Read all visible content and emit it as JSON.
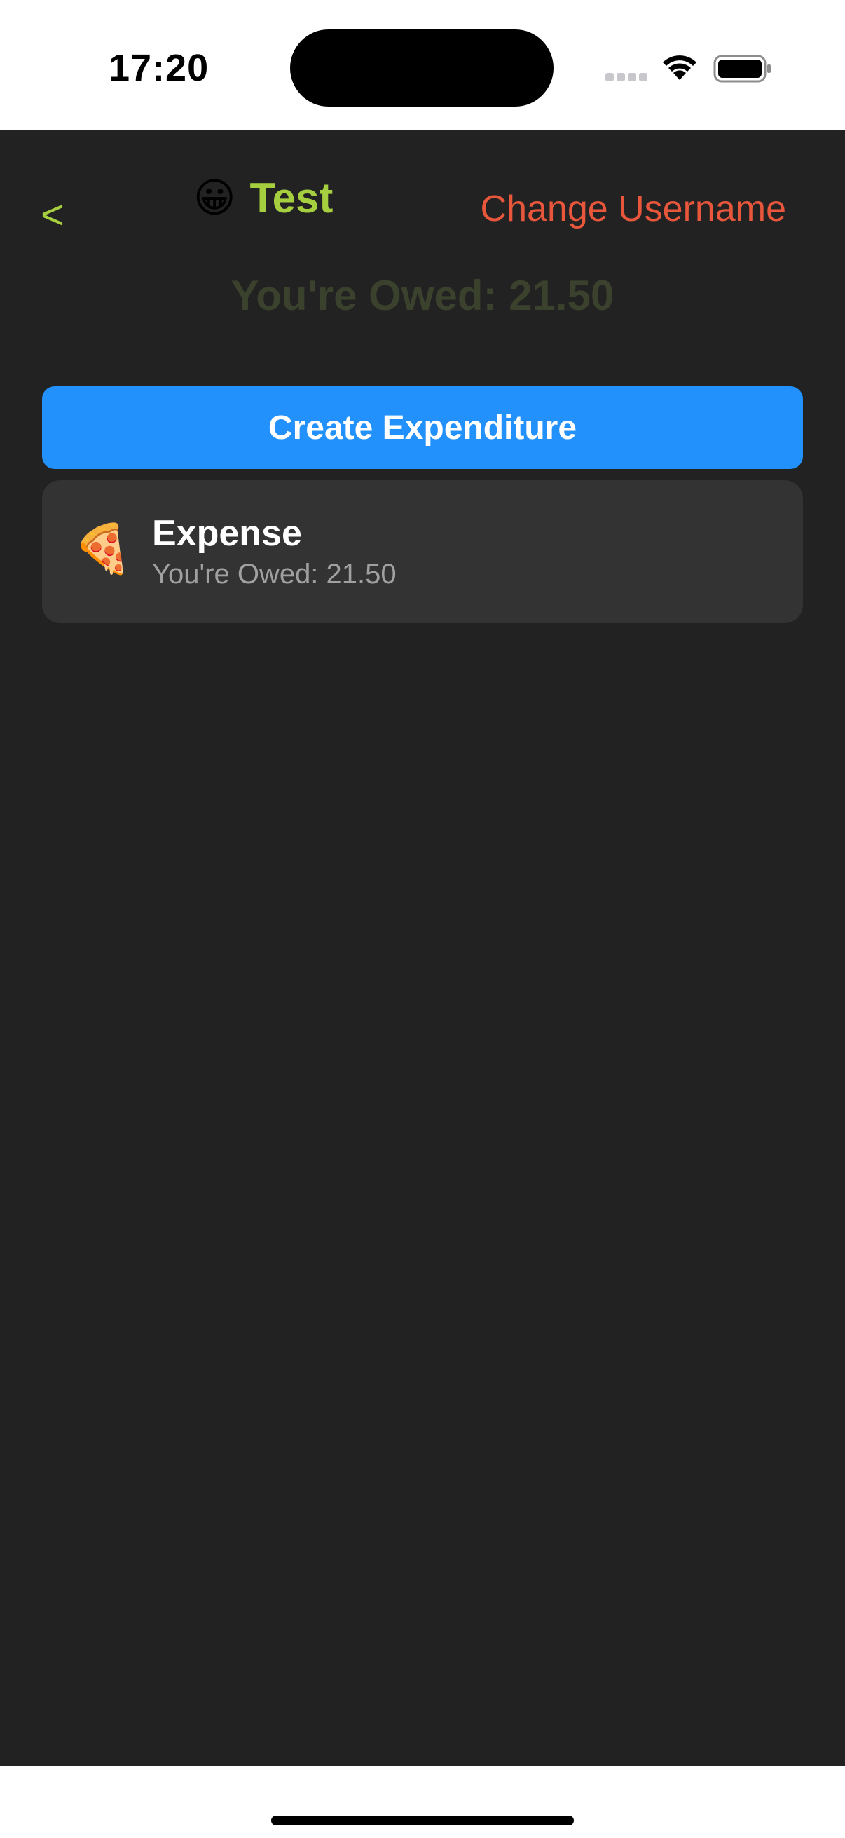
{
  "status_bar": {
    "time": "17:20",
    "icons": [
      "cellular-signal-icon",
      "wifi-icon",
      "battery-icon"
    ]
  },
  "header": {
    "back_label": "<",
    "title_emoji": "😀",
    "title": "Test",
    "change_username_label": "Change Username"
  },
  "summary": {
    "owed_text": "You're Owed: 21.50"
  },
  "actions": {
    "create_expenditure_label": "Create Expenditure"
  },
  "expenses": [
    {
      "emoji": "🍕",
      "title": "Expense",
      "subtitle": "You're Owed: 21.50"
    }
  ],
  "colors": {
    "background": "#222222",
    "accent_green": "#a6cf3f",
    "accent_red": "#e8573c",
    "primary_blue": "#2291fb",
    "card": "#333333",
    "muted_green": "#3a412c"
  }
}
